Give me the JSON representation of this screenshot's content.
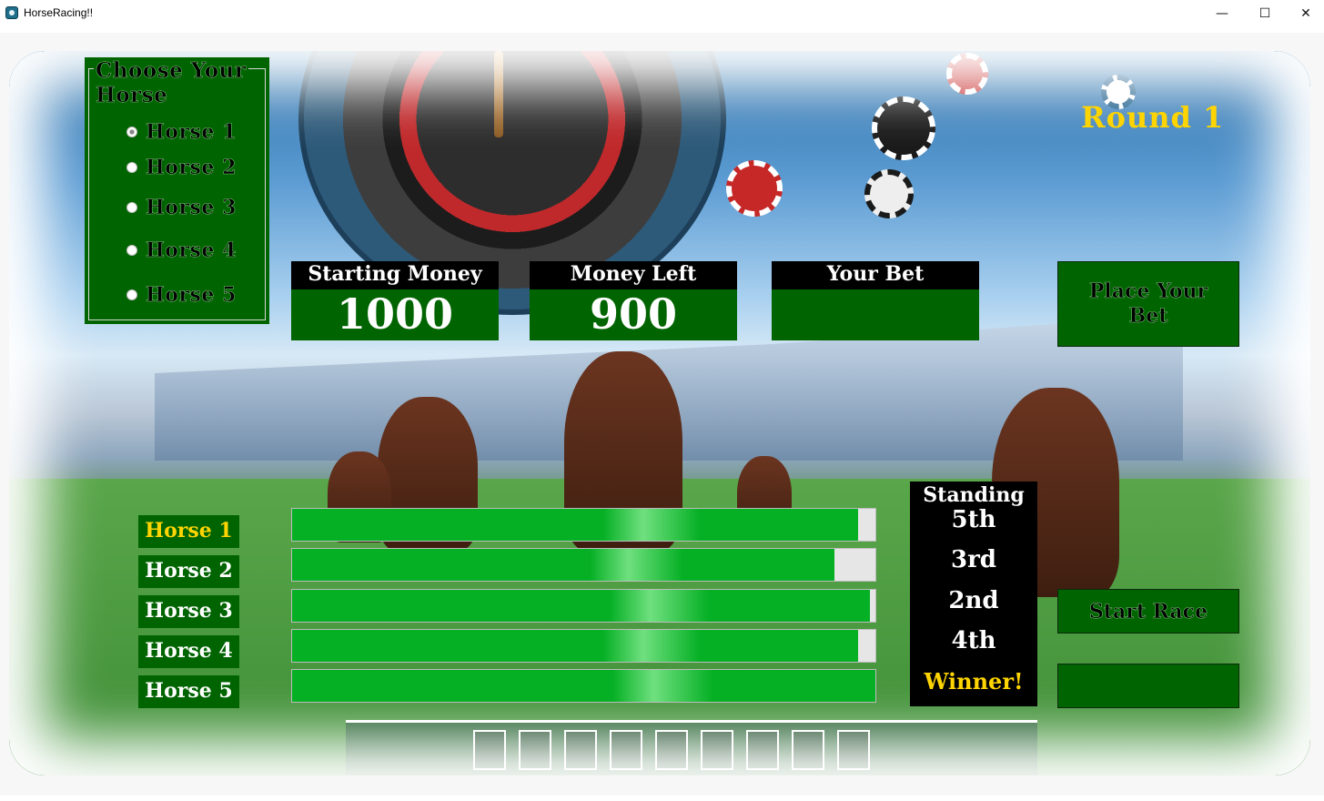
{
  "window": {
    "title": "HorseRacing!!",
    "minimize_glyph": "—",
    "maximize_glyph": "☐",
    "close_glyph": "✕"
  },
  "choose": {
    "title": "Choose Your Horse",
    "options": [
      "Horse 1",
      "Horse 2",
      "Horse 3",
      "Horse 4",
      "Horse 5"
    ],
    "selected_index": 0
  },
  "money": {
    "starting_label": "Starting Money",
    "starting_value": "1000",
    "left_label": "Money Left",
    "left_value": "900",
    "bet_label": "Your Bet",
    "bet_value": ""
  },
  "buttons": {
    "place_bet": "Place Your Bet",
    "start_race": "Start Race",
    "result": ""
  },
  "round": "Round 1",
  "race": {
    "horses": [
      {
        "label": "Horse 1",
        "progress": 97,
        "leader": true
      },
      {
        "label": "Horse 2",
        "progress": 93,
        "leader": false
      },
      {
        "label": "Horse 3",
        "progress": 99,
        "leader": false
      },
      {
        "label": "Horse 4",
        "progress": 97,
        "leader": false
      },
      {
        "label": "Horse 5",
        "progress": 100,
        "leader": false
      }
    ]
  },
  "standings": {
    "title": "Standing",
    "places": [
      "5th",
      "3rd",
      "2nd",
      "4th",
      "Winner!"
    ]
  },
  "colors": {
    "panel_green": "#006400",
    "bar_green": "#06b025",
    "gold": "#ffd400"
  }
}
